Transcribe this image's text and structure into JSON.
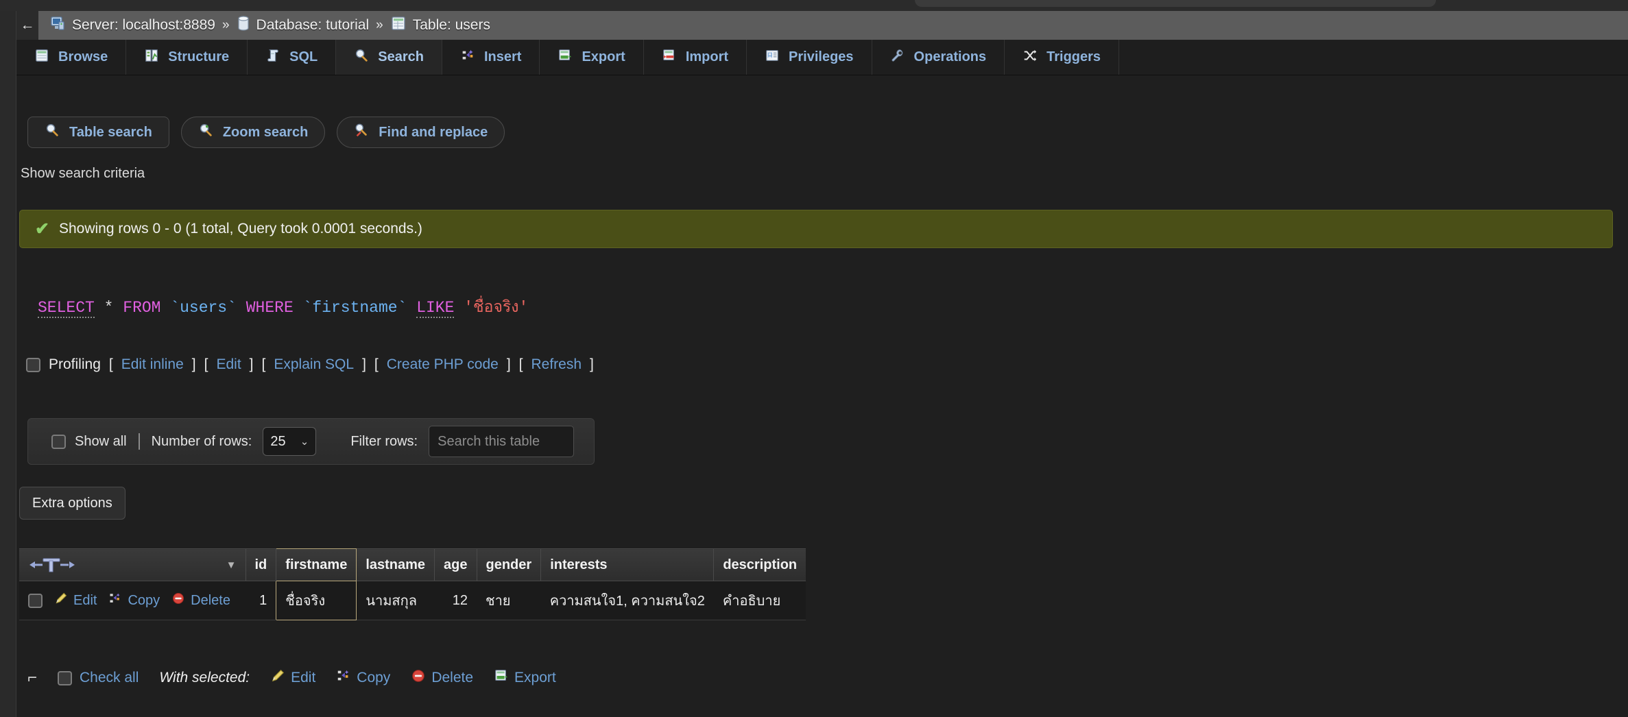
{
  "breadcrumb": {
    "back_label": "←",
    "items": [
      {
        "icon": "server-icon",
        "label": "Server: localhost:8889"
      },
      {
        "icon": "database-icon",
        "label": "Database: tutorial"
      },
      {
        "icon": "table-icon",
        "label": "Table: users"
      }
    ],
    "separator": "»"
  },
  "tabs": [
    {
      "icon": "browse-icon",
      "label": "Browse",
      "active": false
    },
    {
      "icon": "structure-icon",
      "label": "Structure",
      "active": false
    },
    {
      "icon": "sql-icon",
      "label": "SQL",
      "active": false
    },
    {
      "icon": "search-icon",
      "label": "Search",
      "active": true
    },
    {
      "icon": "insert-icon",
      "label": "Insert",
      "active": false
    },
    {
      "icon": "export-icon",
      "label": "Export",
      "active": false
    },
    {
      "icon": "import-icon",
      "label": "Import",
      "active": false
    },
    {
      "icon": "privileges-icon",
      "label": "Privileges",
      "active": false
    },
    {
      "icon": "operations-icon",
      "label": "Operations",
      "active": false
    },
    {
      "icon": "triggers-icon",
      "label": "Triggers",
      "active": false
    }
  ],
  "subtabs": [
    {
      "icon": "magnifier-icon",
      "label": "Table search"
    },
    {
      "icon": "zoom-search-icon",
      "label": "Zoom search"
    },
    {
      "icon": "find-replace-icon",
      "label": "Find and replace"
    }
  ],
  "show_criteria": "Show search criteria",
  "banner": {
    "check_icon": "checkmark-icon",
    "text": "Showing rows 0 - 0 (1 total, Query took 0.0001 seconds.)"
  },
  "sql": {
    "select": "SELECT",
    "star": "*",
    "from": "FROM",
    "table": "`users`",
    "where": "WHERE",
    "column": "`firstname`",
    "like": "LIKE",
    "value": "'ชื่อจริง'"
  },
  "profiling": {
    "label": "Profiling",
    "links": [
      "Edit inline",
      "Edit",
      "Explain SQL",
      "Create PHP code",
      "Refresh"
    ],
    "open_bracket": "[",
    "close_bracket": "]"
  },
  "rowctl": {
    "show_all": "Show all",
    "number_of_rows": "Number of rows:",
    "rows_value": "25",
    "chevron": "⌄",
    "filter_rows": "Filter rows:",
    "filter_placeholder": "Search this table",
    "filter_value": ""
  },
  "extra_options": "Extra options",
  "table": {
    "sort_icons": {
      "left": "⇐",
      "middle": "T",
      "right": "⇒",
      "dropdown": "▼"
    },
    "columns": [
      "id",
      "firstname",
      "lastname",
      "age",
      "gender",
      "interests",
      "description"
    ],
    "highlighted_column": "firstname",
    "row_actions": [
      {
        "icon": "pencil-icon",
        "label": "Edit"
      },
      {
        "icon": "copy-icon",
        "label": "Copy"
      },
      {
        "icon": "delete-icon",
        "label": "Delete"
      }
    ],
    "rows": [
      {
        "id": "1",
        "firstname": "ชื่อจริง",
        "lastname": "นามสกุล",
        "age": "12",
        "gender": "ชาย",
        "interests": "ความสนใจ1, ความสนใจ2",
        "description": "คำอธิบาย"
      }
    ]
  },
  "footer": {
    "corner_icon": "up-left-arrow-icon",
    "check_all": "Check all",
    "with_selected": "With selected:",
    "actions": [
      {
        "icon": "pencil-icon",
        "label": "Edit"
      },
      {
        "icon": "copy-icon",
        "label": "Copy"
      },
      {
        "icon": "delete-icon",
        "label": "Delete"
      },
      {
        "icon": "export-icon",
        "label": "Export"
      }
    ]
  },
  "colors": {
    "banner_bg": "#4a4f17",
    "link": "#6d9fd4",
    "tab_text": "#8fb4dd",
    "sql_keyword": "#e060e0",
    "sql_identifier": "#6db3f2",
    "sql_string": "#e8655f",
    "highlight_border": "#b9a87c"
  }
}
